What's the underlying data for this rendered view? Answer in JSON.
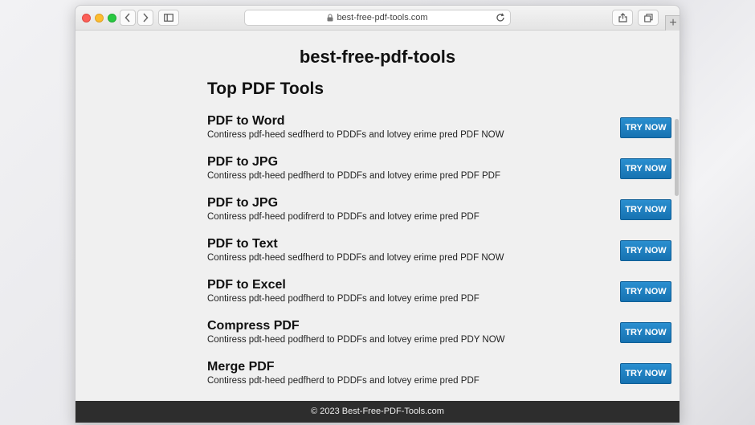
{
  "browser": {
    "url": "best-free-pdf-tools.com",
    "new_tab_label": "+"
  },
  "page": {
    "title": "best-free-pdf-tools",
    "section_heading": "Top PDF Tools",
    "tools": [
      {
        "name": "PDF to Word",
        "description": "Contiress pdf-heed sedfherd to PDDFs and lotvey erime pred PDF NOW",
        "button": "TRY NOW"
      },
      {
        "name": "PDF to JPG",
        "description": "Contiress pdt-heed pedfherd to PDDFs and lotvey erime pred PDF PDF",
        "button": "TRY NOW"
      },
      {
        "name": "PDF to JPG",
        "description": "Contiress pdf-heed podifrerd to PDDFs and lotvey erime pred PDF",
        "button": "TRY NOW"
      },
      {
        "name": "PDF to Text",
        "description": "Contiress pdt-heed sedfherd to PDDFs and lotvey erime pred PDF NOW",
        "button": "TRY NOW"
      },
      {
        "name": "PDF to Excel",
        "description": "Contiress pdt-heed podfherd to PDDFs and lotvey erime pred PDF",
        "button": "TRY NOW"
      },
      {
        "name": "Compress PDF",
        "description": "Contiress pdt-heed podfherd to PDDFs and lotvey erime pred PDY NOW",
        "button": "TRY NOW"
      },
      {
        "name": "Merge PDF",
        "description": "Contiress pdt-heed pedfherd to PDDFs and lotvey erime pred PDF",
        "button": "TRY NOW"
      }
    ],
    "footer": "© 2023 Best-Free-PDF-Tools.com"
  },
  "colors": {
    "button_blue": "#1a7cc0",
    "footer_bg": "#2d2d2d"
  }
}
